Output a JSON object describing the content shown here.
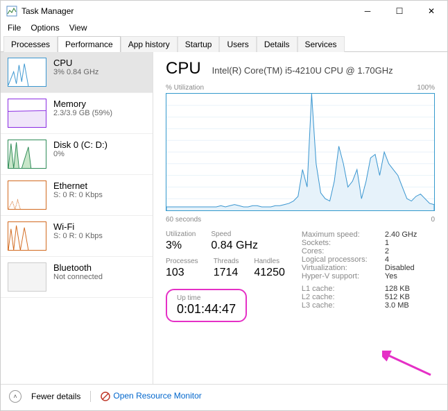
{
  "window": {
    "title": "Task Manager"
  },
  "menu": {
    "file": "File",
    "options": "Options",
    "view": "View"
  },
  "tabs": {
    "processes": "Processes",
    "performance": "Performance",
    "app_history": "App history",
    "startup": "Startup",
    "users": "Users",
    "details": "Details",
    "services": "Services"
  },
  "sidebar": {
    "cpu": {
      "name": "CPU",
      "sub": "3% 0.84 GHz"
    },
    "memory": {
      "name": "Memory",
      "sub": "2.3/3.9 GB (59%)"
    },
    "disk": {
      "name": "Disk 0 (C: D:)",
      "sub": "0%"
    },
    "ethernet": {
      "name": "Ethernet",
      "sub": "S: 0 R: 0 Kbps"
    },
    "wifi": {
      "name": "Wi-Fi",
      "sub": "S: 0 R: 0 Kbps"
    },
    "bluetooth": {
      "name": "Bluetooth",
      "sub": "Not connected"
    }
  },
  "main": {
    "title": "CPU",
    "desc": "Intel(R) Core(TM) i5-4210U CPU @ 1.70GHz",
    "util_label": "% Utilization",
    "util_max": "100%",
    "x_left": "60 seconds",
    "x_right": "0",
    "stats": {
      "utilization": {
        "lbl": "Utilization",
        "val": "3%"
      },
      "speed": {
        "lbl": "Speed",
        "val": "0.84 GHz"
      },
      "processes": {
        "lbl": "Processes",
        "val": "103"
      },
      "threads": {
        "lbl": "Threads",
        "val": "1714"
      },
      "handles": {
        "lbl": "Handles",
        "val": "41250"
      },
      "uptime": {
        "lbl": "Up time",
        "val": "0:01:44:47"
      }
    },
    "info": {
      "max_speed": {
        "k": "Maximum speed:",
        "v": "2.40 GHz"
      },
      "sockets": {
        "k": "Sockets:",
        "v": "1"
      },
      "cores": {
        "k": "Cores:",
        "v": "2"
      },
      "logical": {
        "k": "Logical processors:",
        "v": "4"
      },
      "virt": {
        "k": "Virtualization:",
        "v": "Disabled"
      },
      "hyperv": {
        "k": "Hyper-V support:",
        "v": "Yes"
      },
      "l1": {
        "k": "L1 cache:",
        "v": "128 KB"
      },
      "l2": {
        "k": "L2 cache:",
        "v": "512 KB"
      },
      "l3": {
        "k": "L3 cache:",
        "v": "3.0 MB"
      }
    }
  },
  "footer": {
    "fewer": "Fewer details",
    "resmon": "Open Resource Monitor"
  },
  "colors": {
    "cpu": "#3a96d0",
    "mem": "#8a2be2",
    "disk": "#2e8b57",
    "net": "#d2691e"
  },
  "chart_data": {
    "type": "line",
    "title": "% Utilization",
    "xlabel": "60 seconds → 0",
    "ylabel": "% Utilization",
    "ylim": [
      0,
      100
    ],
    "x": [
      0,
      1,
      2,
      3,
      4,
      5,
      6,
      7,
      8,
      9,
      10,
      11,
      12,
      13,
      14,
      15,
      16,
      17,
      18,
      19,
      20,
      21,
      22,
      23,
      24,
      25,
      26,
      27,
      28,
      29,
      30,
      31,
      32,
      33,
      34,
      35,
      36,
      37,
      38,
      39,
      40,
      41,
      42,
      43,
      44,
      45,
      46,
      47,
      48,
      49,
      50,
      51,
      52,
      53,
      54,
      55,
      56,
      57,
      58,
      59
    ],
    "values": [
      3,
      3,
      3,
      3,
      3,
      3,
      3,
      3,
      3,
      3,
      3,
      3,
      4,
      3,
      4,
      5,
      4,
      3,
      3,
      4,
      4,
      3,
      3,
      3,
      4,
      4,
      5,
      6,
      8,
      12,
      35,
      20,
      100,
      40,
      15,
      10,
      8,
      25,
      55,
      40,
      20,
      25,
      35,
      10,
      25,
      45,
      48,
      30,
      50,
      40,
      35,
      30,
      20,
      10,
      8,
      12,
      14,
      10,
      6,
      5
    ]
  }
}
